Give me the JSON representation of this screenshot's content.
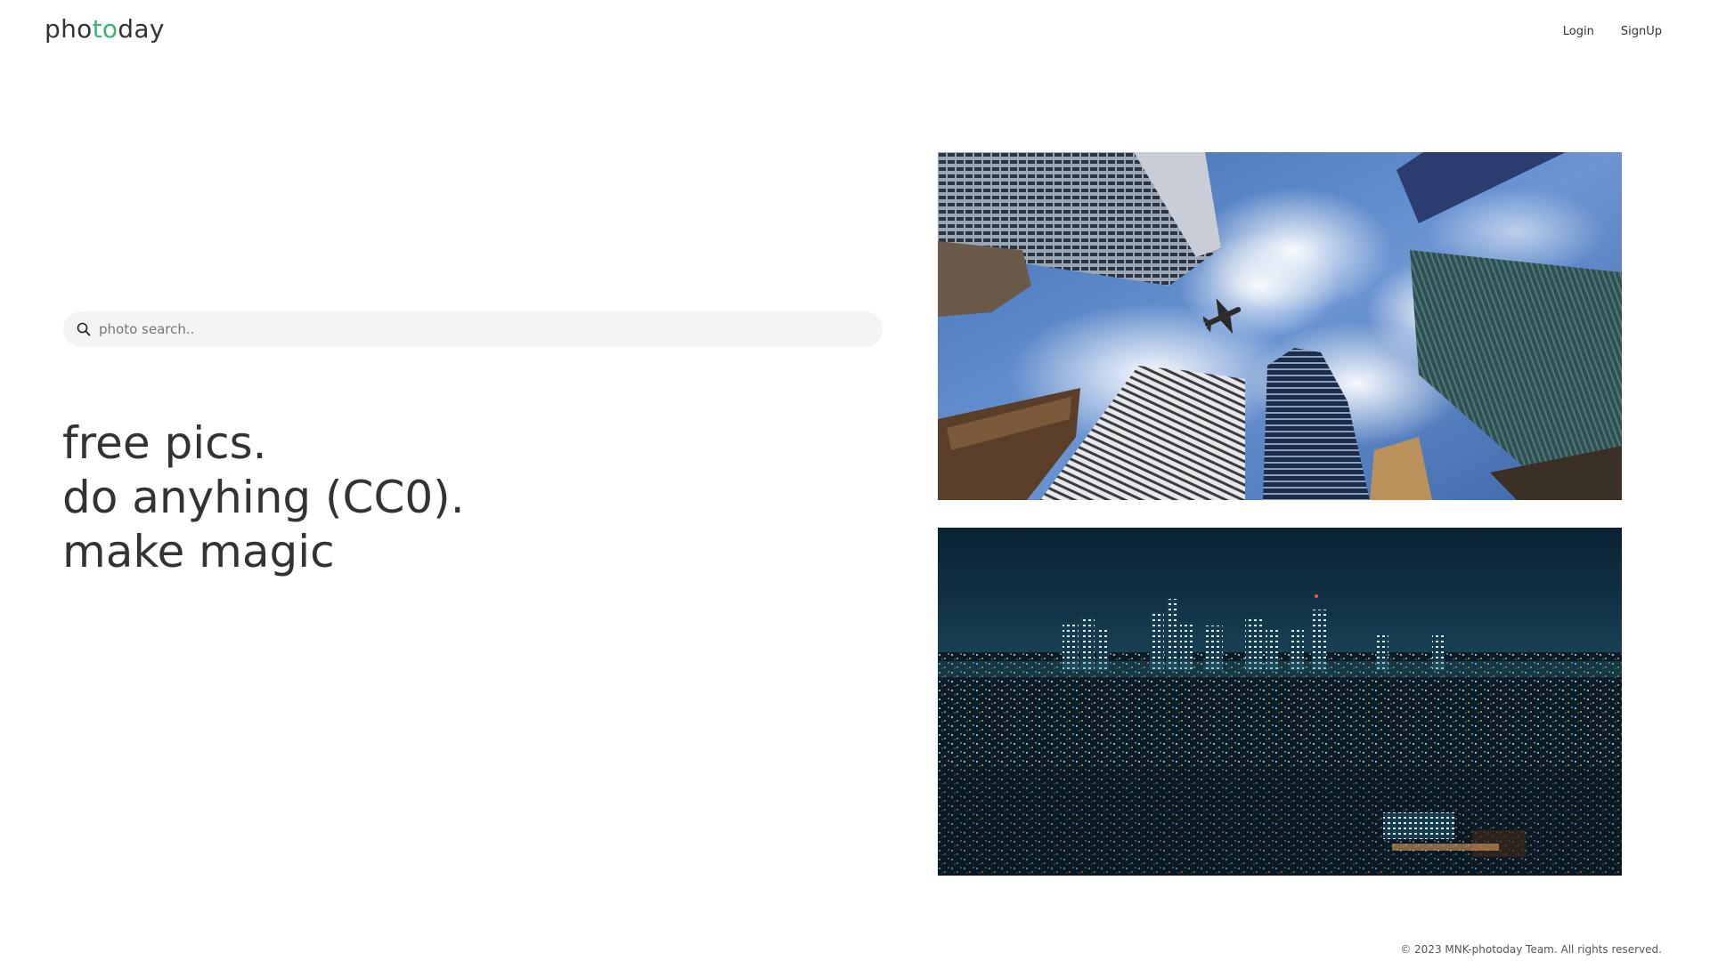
{
  "header": {
    "logo": {
      "part1": "pho",
      "part2": "to",
      "part3": "day"
    },
    "nav": {
      "login": "Login",
      "signup": "SignUp"
    }
  },
  "search": {
    "placeholder": "photo search..",
    "icon": "search-icon"
  },
  "hero": {
    "lines": [
      "free pics.",
      "do anyhing (CC0).",
      "make magic"
    ]
  },
  "gallery": {
    "images": [
      {
        "name": "skyscrapers-looking-up-with-airplane"
      },
      {
        "name": "city-skyline-at-night"
      }
    ]
  },
  "footer": {
    "copyright": "© 2023 MNK-photoday Team. All rights reserved."
  },
  "colors": {
    "accent": "#3cb371",
    "text": "#333333",
    "search_bg": "#f4f4f4"
  }
}
